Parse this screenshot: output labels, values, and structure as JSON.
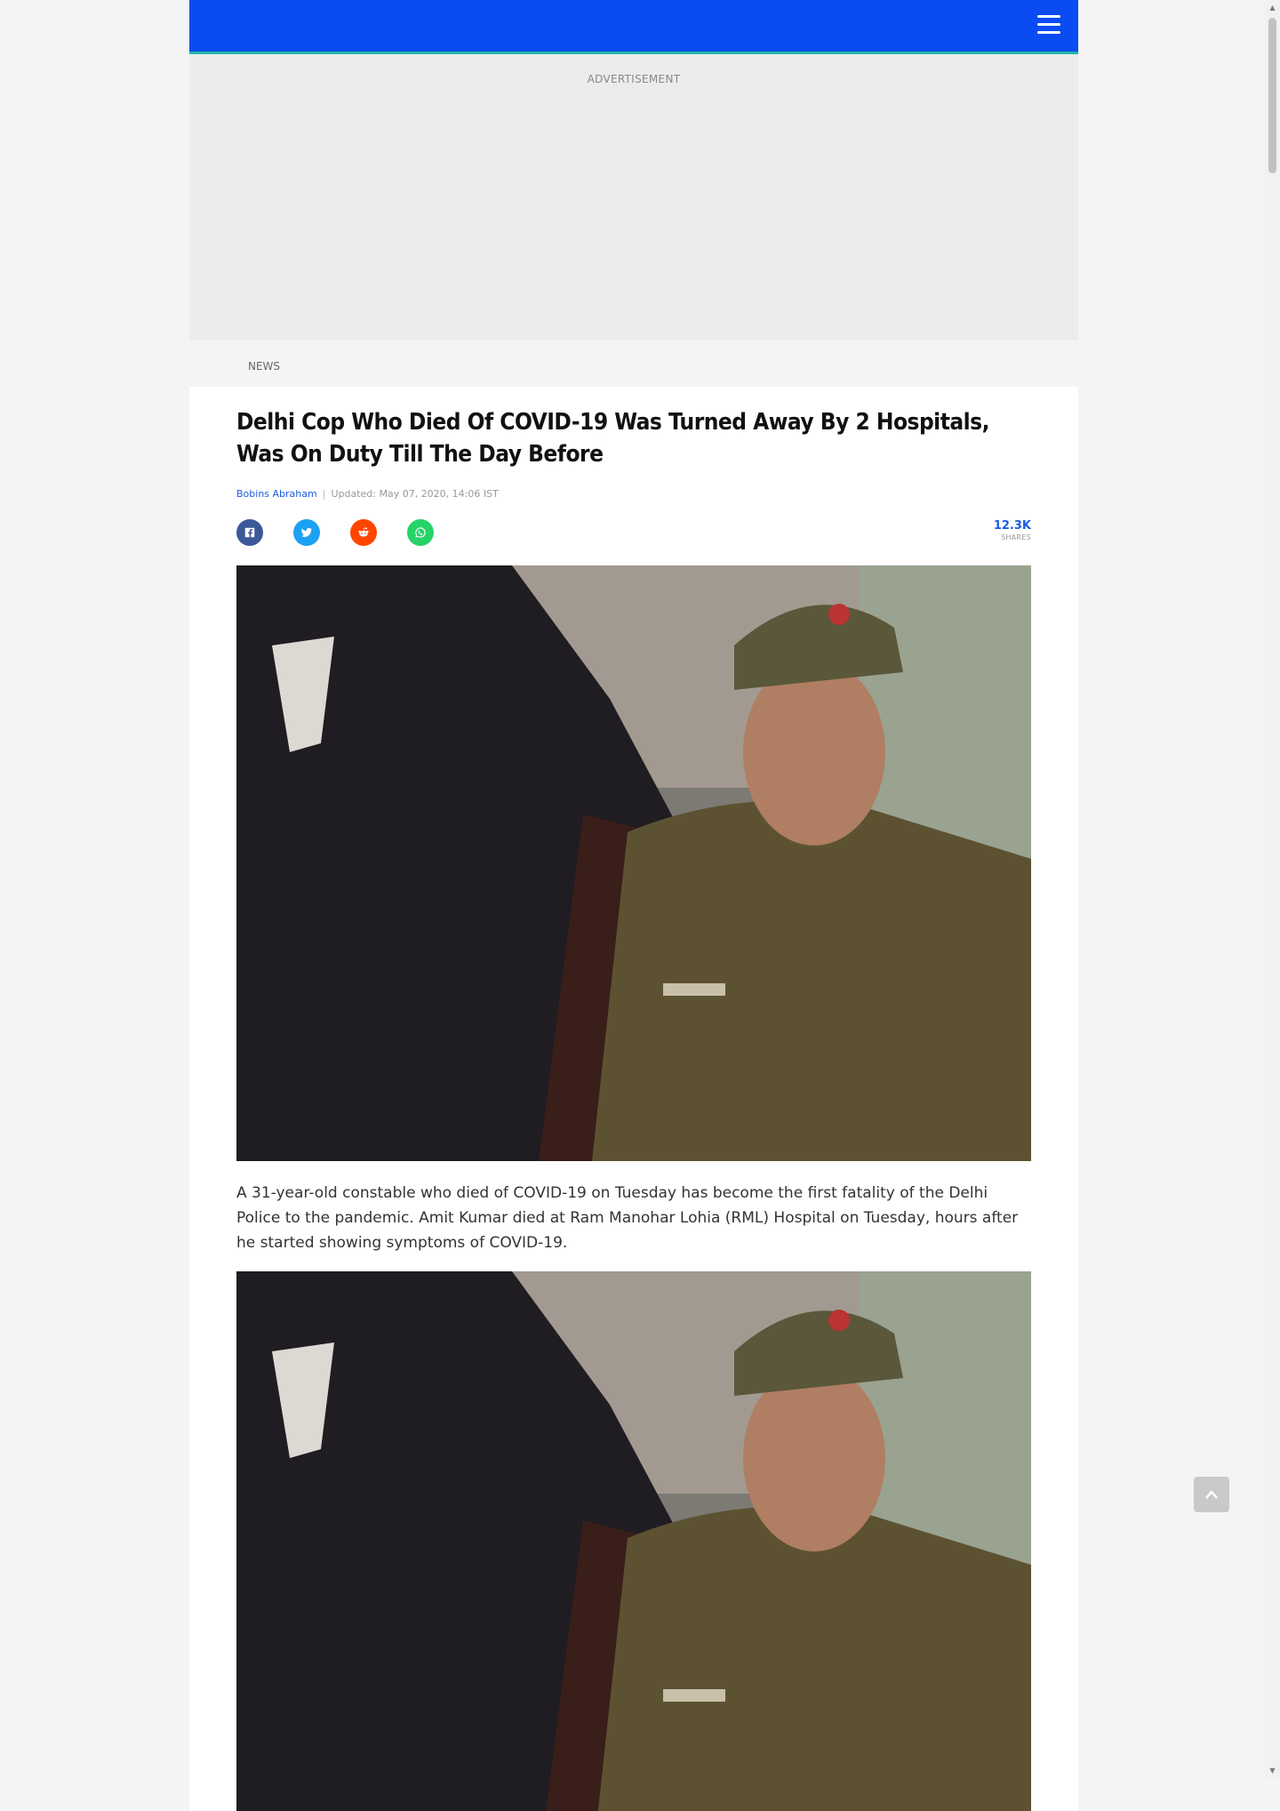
{
  "header": {
    "menu_icon": "hamburger-menu-icon",
    "brand_color": "#0b4cf2"
  },
  "ad": {
    "label": "ADVERTISEMENT"
  },
  "section": {
    "label": "NEWS"
  },
  "article": {
    "title": "Delhi Cop Who Died Of COVID-19 Was Turned Away By 2 Hospitals, Was On Duty Till The Day Before",
    "author": "Bobins Abraham",
    "separator": "|",
    "updated": "Updated: May 07, 2020, 14:06 IST",
    "share": {
      "icons": [
        "facebook-icon",
        "twitter-icon",
        "reddit-icon",
        "whatsapp-icon"
      ],
      "count": "12.3K",
      "count_label": "SHARES"
    },
    "paragraph1": "A 31-year-old constable who died of COVID-19 on Tuesday has become the first fatality of the Delhi Police to the pandemic. Amit Kumar died at Ram Manohar Lohia (RML) Hospital on Tuesday, hours after he started showing symptoms of COVID-19."
  },
  "back_to_top": {
    "icon": "chevron-up-icon"
  },
  "scrollbar": {
    "up": "▲",
    "down": "▼"
  }
}
